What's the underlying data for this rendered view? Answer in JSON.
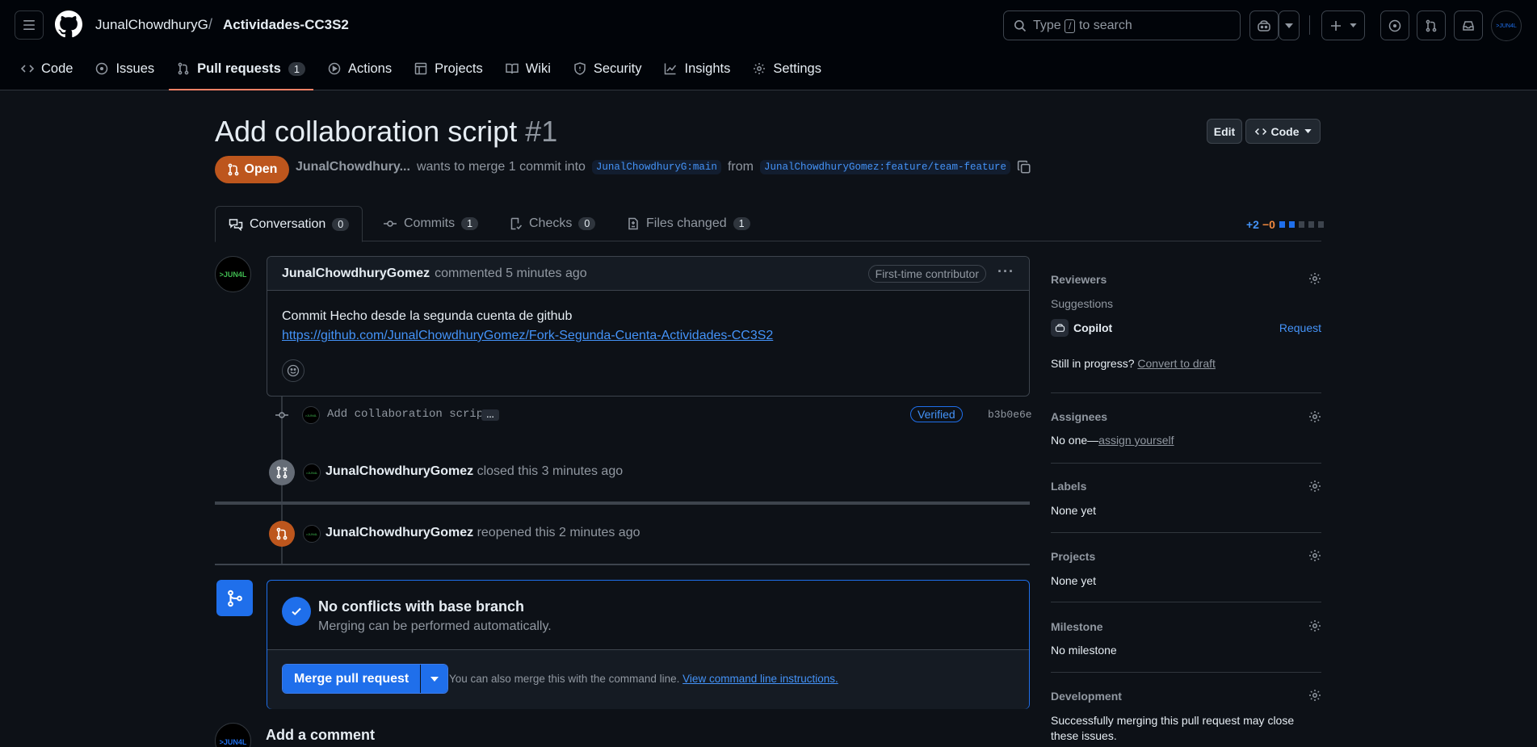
{
  "header": {
    "owner": "JunalChowdhuryG",
    "separator": "/",
    "repo": "Actividades-CC3S2",
    "search_type": "Type",
    "search_key": "/",
    "search_rest": "to search",
    "avatar_text": ">JUN4L"
  },
  "nav": [
    {
      "label": "Code",
      "icon": "code-icon"
    },
    {
      "label": "Issues",
      "icon": "issue-opened-icon"
    },
    {
      "label": "Pull requests",
      "icon": "git-pull-request-icon",
      "count": "1",
      "active": true
    },
    {
      "label": "Actions",
      "icon": "play-icon"
    },
    {
      "label": "Projects",
      "icon": "table-icon"
    },
    {
      "label": "Wiki",
      "icon": "book-icon"
    },
    {
      "label": "Security",
      "icon": "shield-icon"
    },
    {
      "label": "Insights",
      "icon": "graph-icon"
    },
    {
      "label": "Settings",
      "icon": "gear-icon"
    }
  ],
  "pr": {
    "title": "Add collaboration script",
    "number": "#1",
    "edit_label": "Edit",
    "code_label": "Code",
    "state": "Open",
    "author": "JunalChowdhury...",
    "merge_text": "wants to merge 1 commit into",
    "base_branch": "JunalChowdhuryG:main",
    "from_text": "from",
    "head_branch": "JunalChowdhuryGomez:feature/team-feature"
  },
  "tabs": [
    {
      "label": "Conversation",
      "count": "0"
    },
    {
      "label": "Commits",
      "count": "1"
    },
    {
      "label": "Checks",
      "count": "0"
    },
    {
      "label": "Files changed",
      "count": "1"
    }
  ],
  "diffstat": {
    "additions": "+2",
    "deletions": "−0"
  },
  "comment": {
    "avatar_text": ">JUN4L",
    "author": "JunalChowdhuryGomez",
    "action": "commented 5 minutes ago",
    "badge": "First-time contributor",
    "body": "Commit Hecho desde la segunda cuenta de github",
    "link": "https://github.com/JunalChowdhuryGomez/Fork-Segunda-Cuenta-Actividades-CC3S2"
  },
  "commit": {
    "message": "Add collaboration script",
    "ellipsis": "…",
    "verified": "Verified",
    "sha": "b3b0e6e"
  },
  "events": [
    {
      "user": "JunalChowdhuryGomez",
      "text": "closed this 3 minutes ago"
    },
    {
      "user": "JunalChowdhuryGomez",
      "text": "reopened this 2 minutes ago"
    }
  ],
  "merge": {
    "title": "No conflicts with base branch",
    "subtitle": "Merging can be performed automatically.",
    "button": "Merge pull request",
    "hint": "You can also merge this with the command line.",
    "hint_link": "View command line instructions."
  },
  "add_comment": {
    "title": "Add a comment",
    "avatar_text": ">JUN4L"
  },
  "sidebar": {
    "reviewers": {
      "title": "Reviewers",
      "suggestions": "Suggestions",
      "copilot": "Copilot",
      "request": "Request",
      "progress": "Still in progress?",
      "convert": "Convert to draft"
    },
    "assignees": {
      "title": "Assignees",
      "none": "No one—",
      "assign": "assign yourself"
    },
    "labels": {
      "title": "Labels",
      "value": "None yet"
    },
    "projects": {
      "title": "Projects",
      "value": "None yet"
    },
    "milestone": {
      "title": "Milestone",
      "value": "No milestone"
    },
    "development": {
      "title": "Development",
      "value": "Successfully merging this pull request may close these issues."
    }
  },
  "colors": {
    "accent": "#1f6feb",
    "open_state": "#bd561d",
    "tab_underline": "#f78166"
  }
}
